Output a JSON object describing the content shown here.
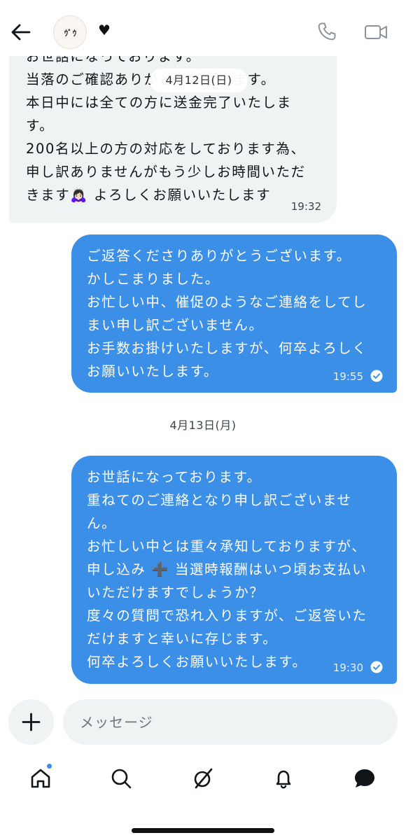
{
  "header": {
    "avatar_text": "ｳﾞｳ",
    "heart": "♥"
  },
  "date_pill": "4月12日(日)",
  "incoming": {
    "text": "お世話になっております。\n当落のご確認ありがとうございます。\n本日中には全ての方に送金完了いたしま\nす。\n200名以上の方の対応をしております為、\n申し訳ありませんがもう少しお時間いただ\nきます🙇🏻‍♀️ よろしくお願いいたします",
    "time": "19:32"
  },
  "outgoing1": {
    "text": "ご返答くださりありがとうございます。\nかしこまりました。\nお忙しい中、催促のようなご連絡をしてし\nまい申し訳ございません。\nお手数お掛けいたしますが、何卒よろしく\nお願いいたします。",
    "time": "19:55"
  },
  "date_divider": "4月13日(月)",
  "outgoing2": {
    "text": "お世話になっております。\n重ねてのご連絡となり申し訳ございませ\nん。\nお忙しい中とは重々承知しておりますが、\n申し込み ➕ 当選時報酬はいつ頃お支払い\nいただけますでしょうか？\n度々の質問で恐れ入りますが、ご返答いた\nだけますと幸いに存じます。\n何卒よろしくお願いいたします。",
    "time": "19:30"
  },
  "composer": {
    "placeholder": "メッセージ"
  },
  "nav": {
    "items": [
      "home-icon",
      "search-icon",
      "grok-icon",
      "notifications-icon",
      "messages-icon"
    ],
    "home_has_badge": true
  },
  "colors": {
    "outgoing_bubble": "#3b8fe7",
    "incoming_bubble": "#eff3f4",
    "text": "#0f1419",
    "secondary": "#6e767d"
  }
}
